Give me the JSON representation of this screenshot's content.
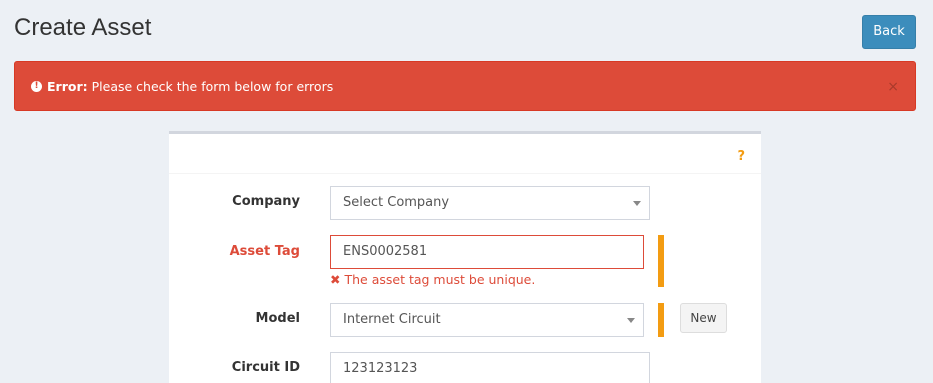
{
  "page": {
    "title": "Create Asset"
  },
  "header": {
    "back_label": "Back"
  },
  "alert": {
    "icon": "exclamation-circle-icon",
    "strong": "Error:",
    "message": "Please check the form below for errors",
    "close": "×"
  },
  "box": {
    "help_glyph": "?"
  },
  "form": {
    "company": {
      "label": "Company",
      "value": "Select Company"
    },
    "asset_tag": {
      "label": "Asset Tag",
      "value": "ENS0002581",
      "error_icon": "✖",
      "error": "The asset tag must be unique."
    },
    "model": {
      "label": "Model",
      "value": "Internet Circuit",
      "new_label": "New"
    },
    "circuit_id": {
      "label": "Circuit ID",
      "value": "123123123"
    }
  },
  "colors": {
    "background": "#ecf0f5",
    "primary": "#3c8dbc",
    "danger": "#dd4b39",
    "warning": "#f39c12"
  }
}
